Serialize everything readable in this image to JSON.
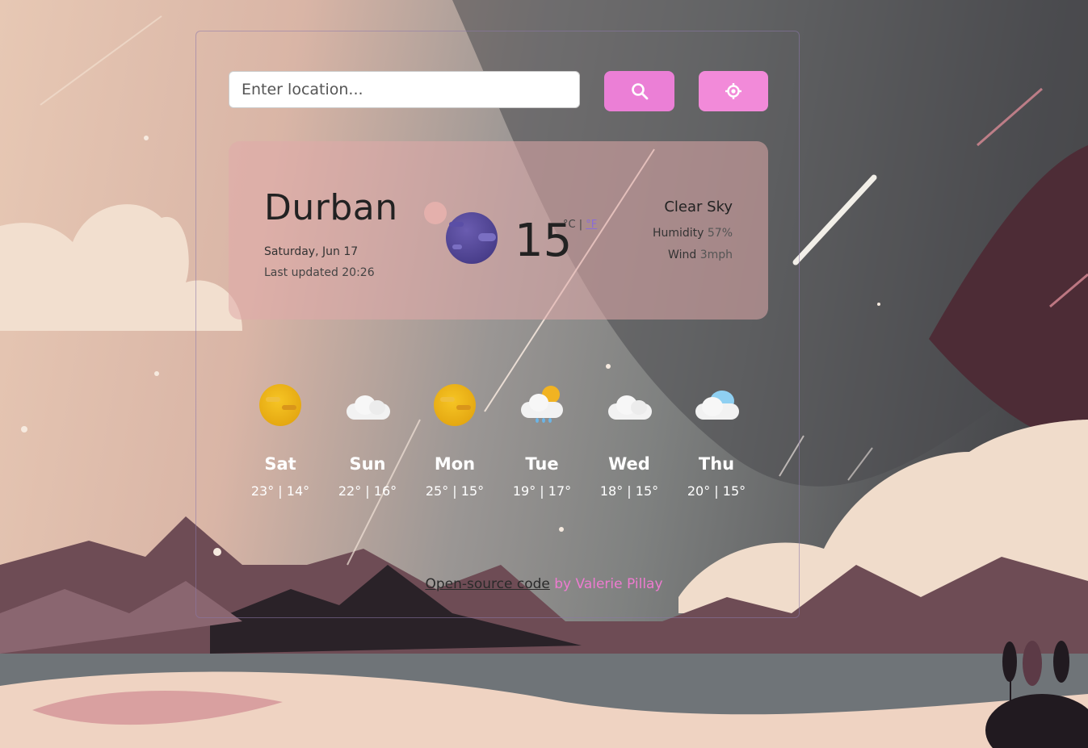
{
  "search": {
    "placeholder": "Enter location..."
  },
  "buttons": {
    "search_icon": "search-icon",
    "locate_icon": "crosshair-icon",
    "search_color": "#eb7fd6",
    "locate_color": "#f28ad9"
  },
  "current": {
    "city": "Durban",
    "date": "Saturday, Jun 17",
    "updated": "Last updated 20:26",
    "temperature": "15",
    "unit_c": "°C |",
    "unit_f": "°F",
    "description": "Clear Sky",
    "humidity_label": "Humidity",
    "humidity_value": "57%",
    "wind_label": "Wind",
    "wind_value": "3mph",
    "icon": "clear-night-planet-icon"
  },
  "forecast": [
    {
      "day": "Sat",
      "range": "23° | 14°",
      "icon": "sun-icon"
    },
    {
      "day": "Sun",
      "range": "22° | 16°",
      "icon": "cloud-icon"
    },
    {
      "day": "Mon",
      "range": "25° | 15°",
      "icon": "sun-icon"
    },
    {
      "day": "Tue",
      "range": "19° | 17°",
      "icon": "sun-rain-cloud-icon"
    },
    {
      "day": "Wed",
      "range": "18° | 15°",
      "icon": "cloud-icon"
    },
    {
      "day": "Thu",
      "range": "20° | 15°",
      "icon": "blue-cloud-icon"
    }
  ],
  "footer": {
    "link": "Open-source code",
    "by": " by Valerie Pillay"
  }
}
